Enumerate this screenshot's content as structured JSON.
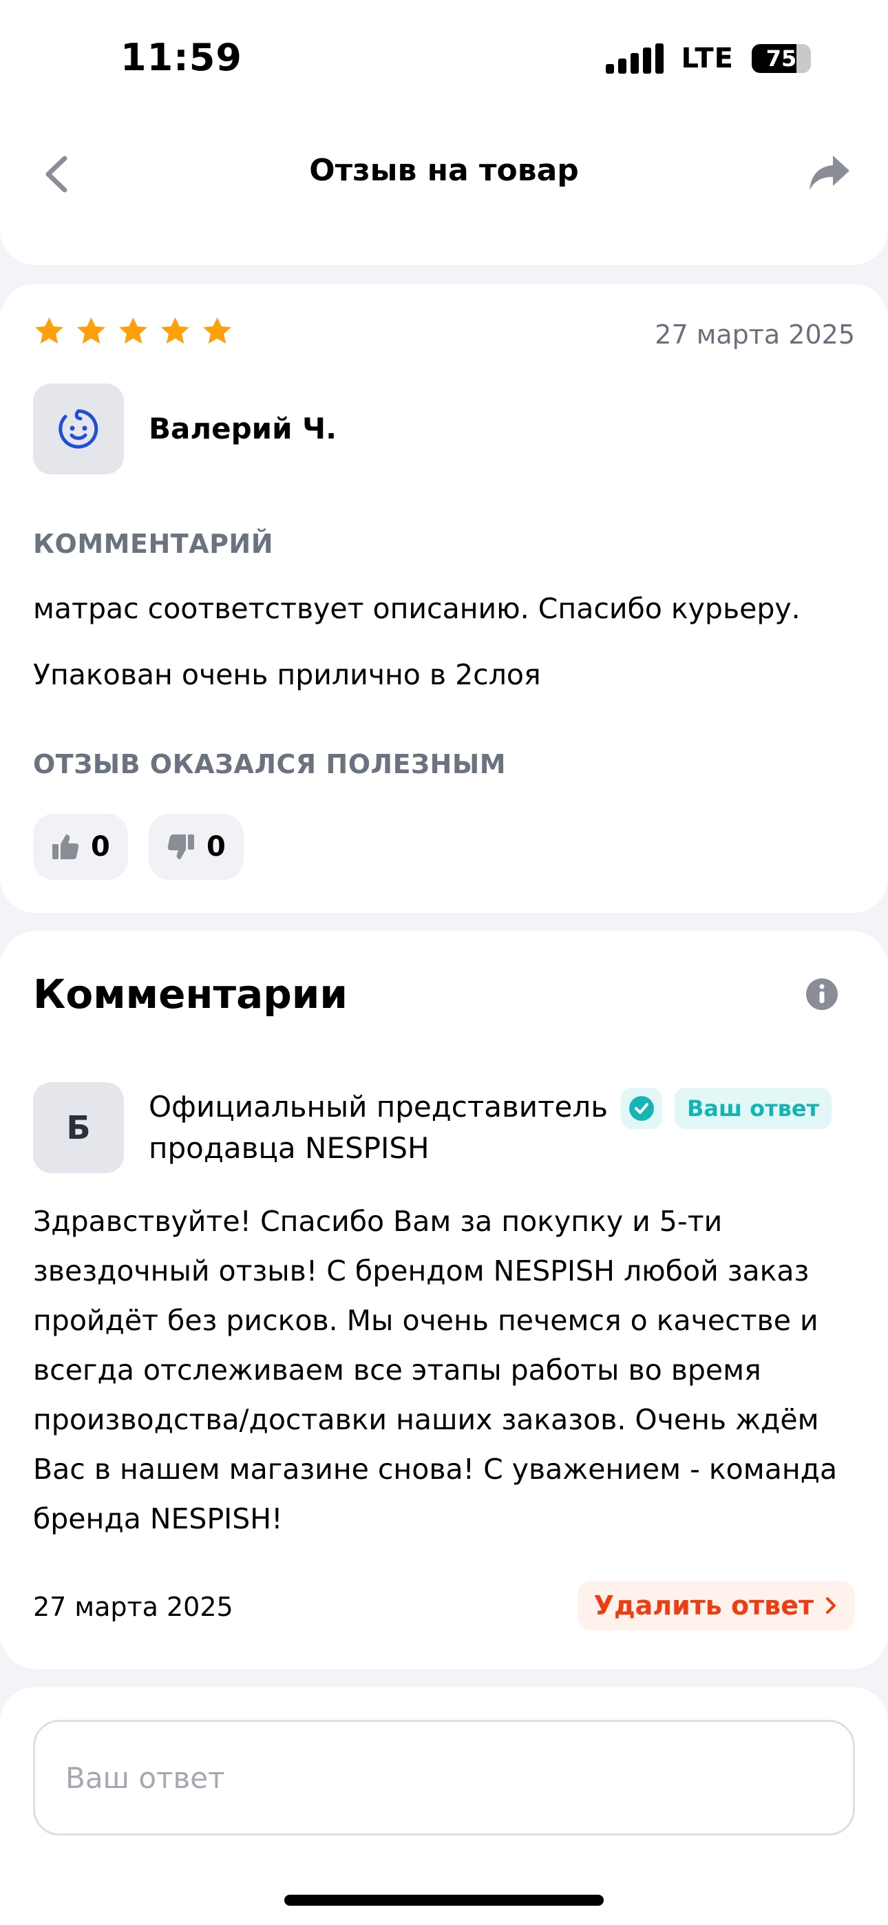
{
  "status_bar": {
    "time": "11:59",
    "network": "LTE",
    "battery_level": "75"
  },
  "header": {
    "title": "Отзыв на товар",
    "back_icon": "chevron-left-icon",
    "share_icon": "share-arrow-icon"
  },
  "review": {
    "rating": 5,
    "date": "27 марта 2025",
    "author": "Валерий Ч.",
    "avatar_icon": "smiley-face-icon",
    "comment_label": "КОММЕНТАРИЙ",
    "comment_lines": [
      "матрас соответствует описанию. Спасибо курьеру.",
      "Упакован очень прилично в 2слоя"
    ],
    "helpful_label": "ОТЗЫВ ОКАЗАЛСЯ ПОЛЕЗНЫМ",
    "likes": "0",
    "dislikes": "0"
  },
  "comments": {
    "title": "Комментарии",
    "info_icon": "info-icon",
    "reply": {
      "avatar_letter": "Б",
      "author": "Официальный представитель продавца NESPISH",
      "badge_label": "Ваш ответ",
      "text": "Здравствуйте! Спасибо Вам за покупку и 5-ти звездочный отзыв! С брендом NESPISH любой заказ пройдёт без рисков. Мы очень печемся о качестве и всегда отслеживаем все этапы работы во время производства/доставки наших заказов. Очень ждём Вас в нашем магазине снова! С уважением - команда бренда NESPISH!",
      "date": "27 марта 2025",
      "delete_label": "Удалить ответ"
    }
  },
  "answer_input": {
    "placeholder": "Ваш ответ",
    "value": ""
  },
  "colors": {
    "star": "#ff9f0a",
    "accent_teal": "#16b5b5",
    "delete_red": "#ec3e12",
    "avatar_icon_blue": "#1f4fd8"
  }
}
